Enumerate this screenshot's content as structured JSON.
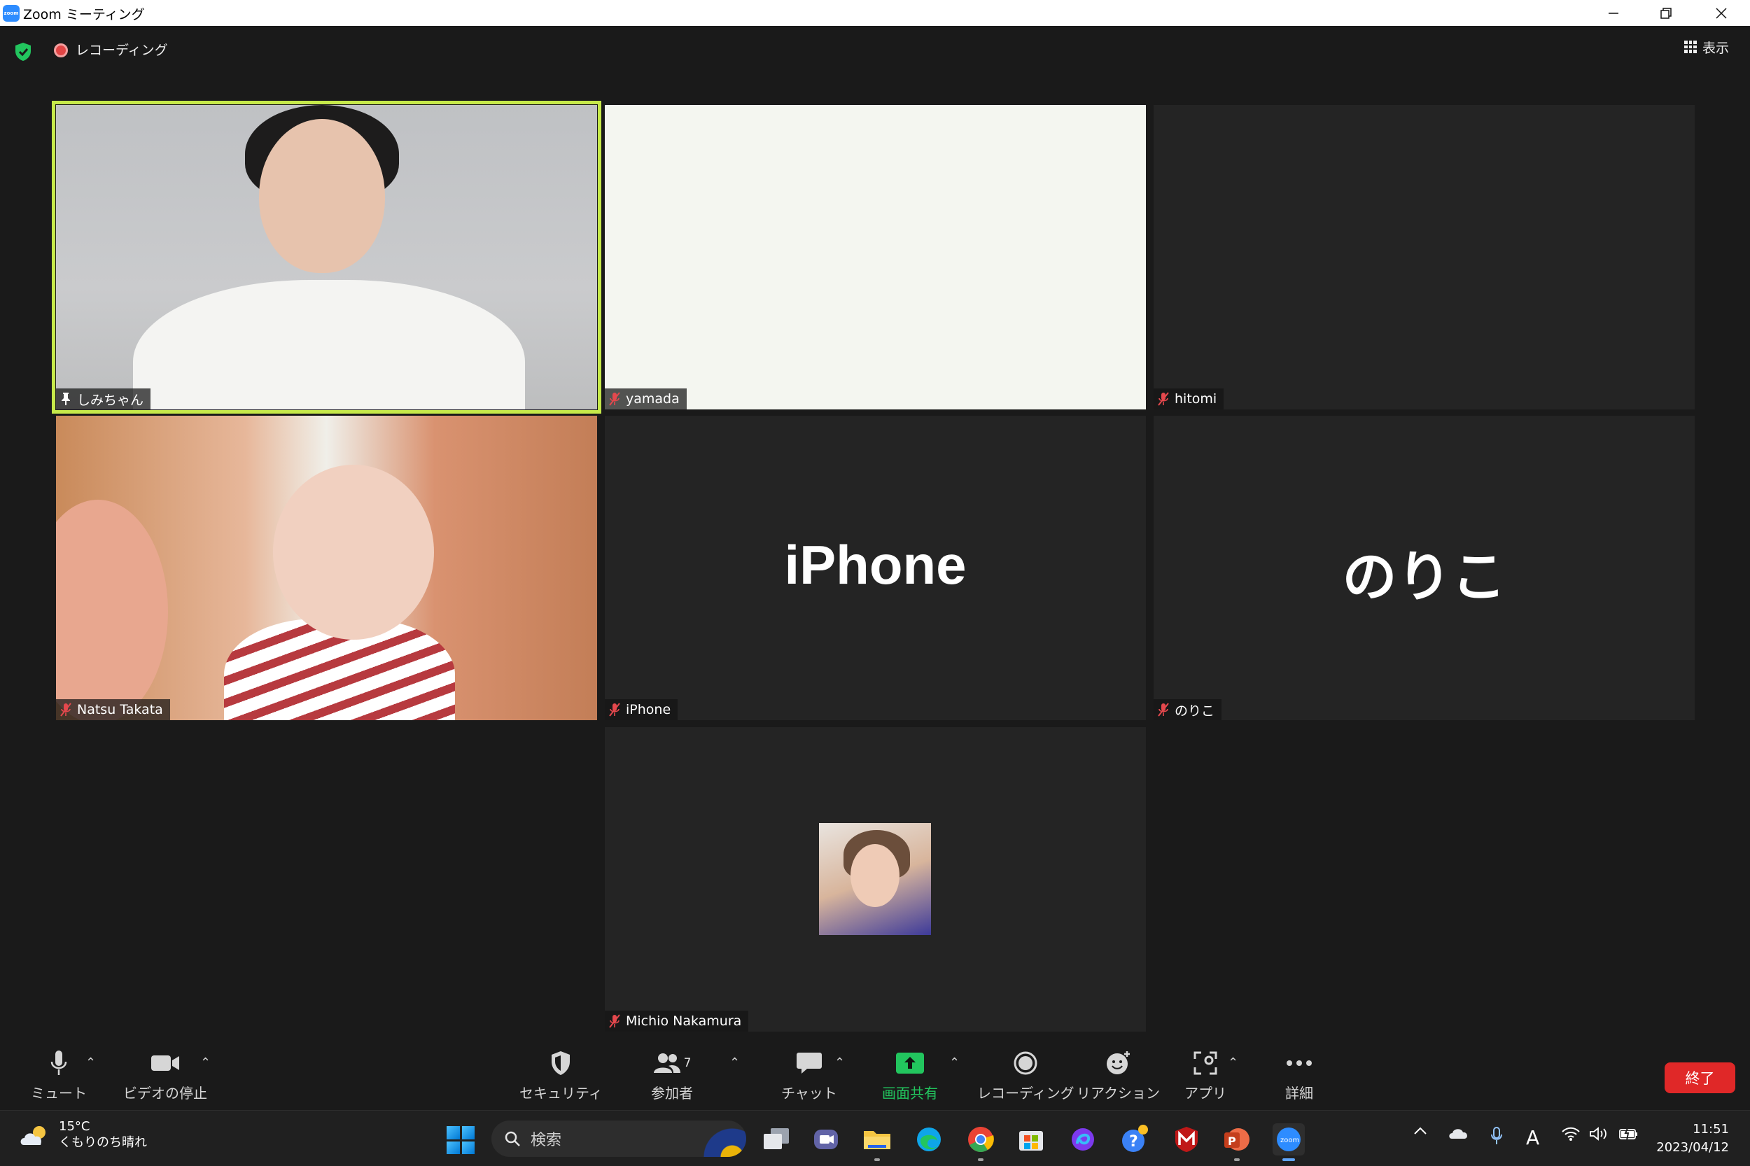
{
  "window": {
    "title": "Zoom ミーティング",
    "app_logo_text": "zoom"
  },
  "topbar": {
    "recording_label": "レコーディング",
    "view_label": "表示"
  },
  "tiles": [
    {
      "name": "しみちゃん",
      "muted": false,
      "pinned": true,
      "speaking": true
    },
    {
      "name": "yamada",
      "muted": true
    },
    {
      "name": "hitomi",
      "muted": true
    },
    {
      "name": "Natsu Takata",
      "muted": true
    },
    {
      "name": "iPhone",
      "muted": true,
      "display_name": "iPhone"
    },
    {
      "name": "のりこ",
      "muted": true,
      "display_name": "のりこ"
    },
    {
      "name": "Michio Nakamura",
      "muted": true
    }
  ],
  "toolbar": {
    "mute": "ミュート",
    "stop_video": "ビデオの停止",
    "security": "セキュリティ",
    "participants": "参加者",
    "participants_count": "7",
    "chat": "チャット",
    "share_screen": "画面共有",
    "recording": "レコーディング",
    "reactions": "リアクション",
    "apps": "アプリ",
    "more": "詳細",
    "end": "終了"
  },
  "taskbar": {
    "weather_temp": "15°C",
    "weather_desc": "くもりのち晴れ",
    "search_placeholder": "検索",
    "time": "11:51",
    "date": "2023/04/12",
    "zoom_icon_text": "zoom",
    "ime_indicator": "A"
  },
  "colors": {
    "active_speaker_border": "#c6e94a",
    "share_green": "#22c55e",
    "end_red": "#e02828",
    "muted_red": "#e5484d"
  }
}
